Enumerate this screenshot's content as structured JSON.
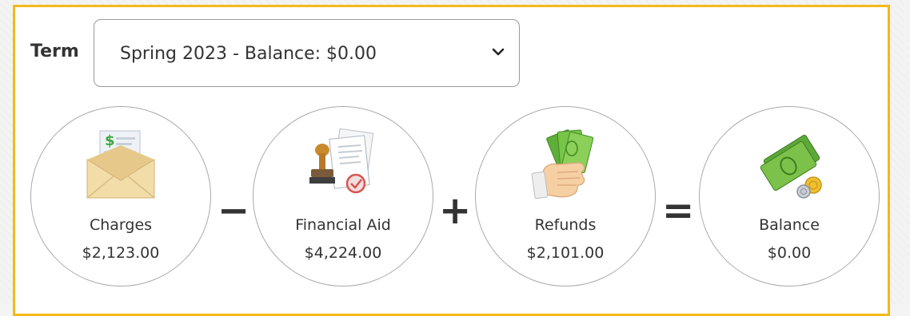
{
  "term": {
    "label": "Term",
    "selected": "Spring 2023 - Balance: $0.00"
  },
  "summary": {
    "charges": {
      "label": "Charges",
      "amount": "$2,123.00",
      "icon": "bill-envelope-icon"
    },
    "op1": "−",
    "aid": {
      "label": "Financial Aid",
      "amount": "$4,224.00",
      "icon": "stamp-document-icon"
    },
    "op2": "+",
    "refunds": {
      "label": "Refunds",
      "amount": "$2,101.00",
      "icon": "hand-cash-icon"
    },
    "op3": "=",
    "balance": {
      "label": "Balance",
      "amount": "$0.00",
      "icon": "money-coins-icon"
    }
  },
  "colors": {
    "panel_border": "#f3b81a",
    "text": "#333333",
    "circle_border": "#aaaaaa"
  }
}
